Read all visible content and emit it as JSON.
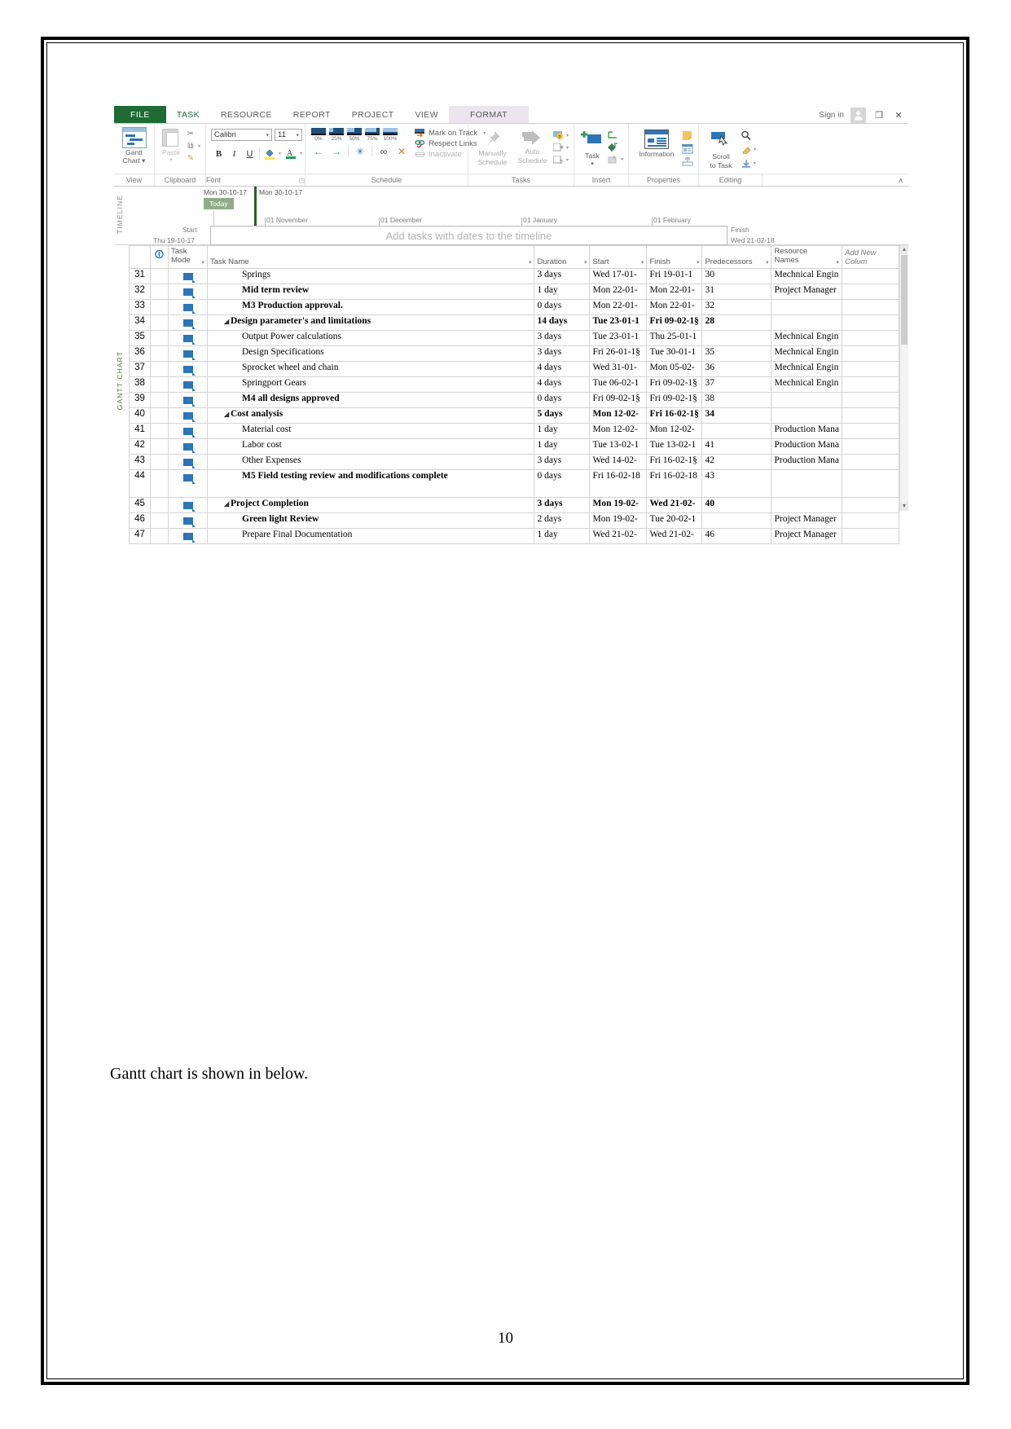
{
  "document": {
    "caption": "Gantt chart is shown in below.",
    "page_number": "10"
  },
  "app": {
    "tabs": [
      {
        "label": "FILE",
        "kind": "file"
      },
      {
        "label": "TASK",
        "kind": "task"
      },
      {
        "label": "RESOURCE",
        "kind": "normal"
      },
      {
        "label": "REPORT",
        "kind": "normal"
      },
      {
        "label": "PROJECT",
        "kind": "normal"
      },
      {
        "label": "VIEW",
        "kind": "normal"
      },
      {
        "label": "FORMAT",
        "kind": "context"
      }
    ],
    "window": {
      "signin": "Sign in",
      "restore": "❐",
      "close": "✕"
    },
    "ribbon": {
      "groups": [
        {
          "label": "View"
        },
        {
          "label": "Clipboard"
        },
        {
          "label": "Font",
          "dialog_launcher": "◳"
        },
        {
          "label": "Schedule"
        },
        {
          "label": "Tasks"
        },
        {
          "label": "Insert"
        },
        {
          "label": "Properties"
        },
        {
          "label": "Editing"
        }
      ],
      "collapse_arrow": "∧",
      "view": {
        "button": "Gantt\nChart",
        "label_line1": "Gantt",
        "label_line2": "Chart ▾"
      },
      "clipboard": {
        "paste": "Paste",
        "paste_arrow": "▾",
        "cut": "✂",
        "copy": "⧉",
        "format_painter": "✎"
      },
      "font": {
        "font_name": "Calibri",
        "font_size": "11",
        "bold": "B",
        "italic": "I",
        "underline": "U",
        "highlight": "A",
        "fontcolor": "A",
        "dropdown_arrow": "▾"
      },
      "schedule": {
        "percents": [
          "0%",
          "25%",
          "50%",
          "75%",
          "100%"
        ],
        "mark_on_track": "Mark on Track",
        "respect_links": "Respect Links",
        "inactivate": "Inactivate",
        "outdent": "←",
        "indent": "→",
        "split": "✳",
        "link": "∞",
        "unlink": "✕"
      },
      "tasks": {
        "manually_schedule": "Manually\nSchedule",
        "manually_line1": "Manually",
        "manually_line2": "Schedule",
        "auto_line1": "Auto",
        "auto_line2": "Schedule",
        "inspect": "?",
        "move": "▦",
        "mode": "▦"
      },
      "insert": {
        "task_line1": "Task",
        "task_line2": "▾",
        "summary": "┳",
        "milestone": "◆",
        "deliverable": "▣"
      },
      "properties": {
        "information": "Information",
        "notes": "▤",
        "details": "▥",
        "add_to_timeline": "⤓"
      },
      "editing": {
        "scroll_line1": "Scroll",
        "scroll_line2": "to Task",
        "find": "⌕",
        "clear": "⌫",
        "fill": "⬇"
      }
    },
    "timeline": {
      "side_label": "TIMELINE",
      "today_label": "Today",
      "today_date_left": "Mon 30-10-17",
      "today_date_right": "Mon 30-10-17",
      "ticks": [
        "01 November",
        "01 December",
        "01 January",
        "01 February"
      ],
      "start_label": "Start",
      "start_date": "Thu 19-10-17",
      "finish_label": "Finish",
      "finish_date": "Wed 21-02-18",
      "placeholder": "Add tasks with dates to the timeline"
    },
    "gantt": {
      "side_label": "GANTT CHART",
      "columns": [
        {
          "key": "id",
          "label": ""
        },
        {
          "key": "ind",
          "label": "ℹ"
        },
        {
          "key": "mode",
          "label": "Task Mode",
          "line1": "Task",
          "line2": "Mode"
        },
        {
          "key": "name",
          "label": "Task Name"
        },
        {
          "key": "duration",
          "label": "Duration"
        },
        {
          "key": "start",
          "label": "Start"
        },
        {
          "key": "finish",
          "label": "Finish"
        },
        {
          "key": "predecessors",
          "label": "Predecessors"
        },
        {
          "key": "resource",
          "label": "Resource Names",
          "line1": "Resource",
          "line2": "Names"
        },
        {
          "key": "addnew",
          "label": "Add New Colum"
        }
      ],
      "rows": [
        {
          "id": "31",
          "name": "Springs",
          "style": "plain",
          "indent": 1,
          "duration": "3 days",
          "start": "Wed 17-01-",
          "finish": "Fri 19-01-1",
          "pred": "30",
          "res": "Mechnical Engin"
        },
        {
          "id": "32",
          "name": "Mid term review",
          "style": "green",
          "indent": 1,
          "duration": "1 day",
          "start": "Mon 22-01-",
          "finish": "Mon 22-01-",
          "pred": "31",
          "res": "Project Manager"
        },
        {
          "id": "33",
          "name": "M3 Production approval.",
          "style": "red",
          "indent": 1,
          "duration": "0 days",
          "start": "Mon 22-01-",
          "finish": "Mon 22-01-",
          "pred": "32",
          "res": ""
        },
        {
          "id": "34",
          "name": "Design parameter's and limitations",
          "style": "summary",
          "indent": 0,
          "caret": "◢",
          "duration": "14 days",
          "start": "Tue 23-01-1",
          "finish": "Fri 09-02-1§",
          "pred": "28",
          "res": ""
        },
        {
          "id": "35",
          "name": "Output Power calculations",
          "style": "plain",
          "indent": 1,
          "duration": "3 days",
          "start": "Tue 23-01-1",
          "finish": "Thu 25-01-1",
          "pred": "",
          "res": "Mechnical Engin"
        },
        {
          "id": "36",
          "name": "Design Specifications",
          "style": "plain",
          "indent": 1,
          "duration": "3 days",
          "start": "Fri 26-01-1§",
          "finish": "Tue 30-01-1",
          "pred": "35",
          "res": "Mechnical Engin"
        },
        {
          "id": "37",
          "name": "Sprocket wheel and chain",
          "style": "plain",
          "indent": 1,
          "duration": "4 days",
          "start": "Wed 31-01-",
          "finish": "Mon 05-02-",
          "pred": "36",
          "res": "Mechnical Engin"
        },
        {
          "id": "38",
          "name": "Springport Gears",
          "style": "plain",
          "indent": 1,
          "duration": "4 days",
          "start": "Tue 06-02-1",
          "finish": "Fri 09-02-1§",
          "pred": "37",
          "res": "Mechnical Engin"
        },
        {
          "id": "39",
          "name": "M4 all designs approved",
          "style": "red",
          "indent": 1,
          "duration": "0 days",
          "start": "Fri 09-02-1§",
          "finish": "Fri 09-02-1§",
          "pred": "38",
          "res": ""
        },
        {
          "id": "40",
          "name": "Cost analysis",
          "style": "summary",
          "indent": 0,
          "caret": "◢",
          "duration": "5 days",
          "start": "Mon 12-02-",
          "finish": "Fri 16-02-1§",
          "pred": "34",
          "res": ""
        },
        {
          "id": "41",
          "name": "Material cost",
          "style": "plain",
          "indent": 1,
          "duration": "1 day",
          "start": "Mon 12-02-",
          "finish": "Mon 12-02-",
          "pred": "",
          "res": "Production Mana"
        },
        {
          "id": "42",
          "name": "Labor cost",
          "style": "plain",
          "indent": 1,
          "duration": "1 day",
          "start": "Tue 13-02-1",
          "finish": "Tue 13-02-1",
          "pred": "41",
          "res": "Production Mana"
        },
        {
          "id": "43",
          "name": "Other Expenses",
          "style": "plain",
          "indent": 1,
          "duration": "3 days",
          "start": "Wed 14-02-",
          "finish": "Fri 16-02-1§",
          "pred": "42",
          "res": "Production Mana"
        },
        {
          "id": "44",
          "name": "M5 Field testing review and modifications complete",
          "style": "red",
          "indent": 1,
          "tall": true,
          "duration": "0 days",
          "start": "Fri 16-02-18",
          "finish": "Fri 16-02-18",
          "pred": "43",
          "res": ""
        },
        {
          "id": "45",
          "name": "Project Completion",
          "style": "summary",
          "indent": 0,
          "caret": "◢",
          "duration": "3 days",
          "start": "Mon 19-02-",
          "finish": "Wed 21-02-",
          "pred": "40",
          "res": ""
        },
        {
          "id": "46",
          "name": "Green light Review",
          "style": "green",
          "indent": 1,
          "duration": "2 days",
          "start": "Mon 19-02-",
          "finish": "Tue 20-02-1",
          "pred": "",
          "res": "Project Manager"
        },
        {
          "id": "47",
          "name": "Prepare Final Documentation",
          "style": "plain",
          "indent": 1,
          "duration": "1 day",
          "start": "Wed 21-02-",
          "finish": "Wed 21-02-",
          "pred": "46",
          "res": "Project Manager"
        }
      ],
      "scroll": {
        "up": "▲",
        "down": "▼"
      }
    }
  },
  "colors": {
    "file_tab_green": "#1e6b33",
    "task_tab_green": "#1e6b33",
    "context_tab": "#ece5f0",
    "milestone_red": "#e8201a",
    "review_green": "#0a9b3f",
    "today_marker": "#8fae87",
    "today_line": "#2f5b2a",
    "accent_blue": "#2e75b6"
  }
}
